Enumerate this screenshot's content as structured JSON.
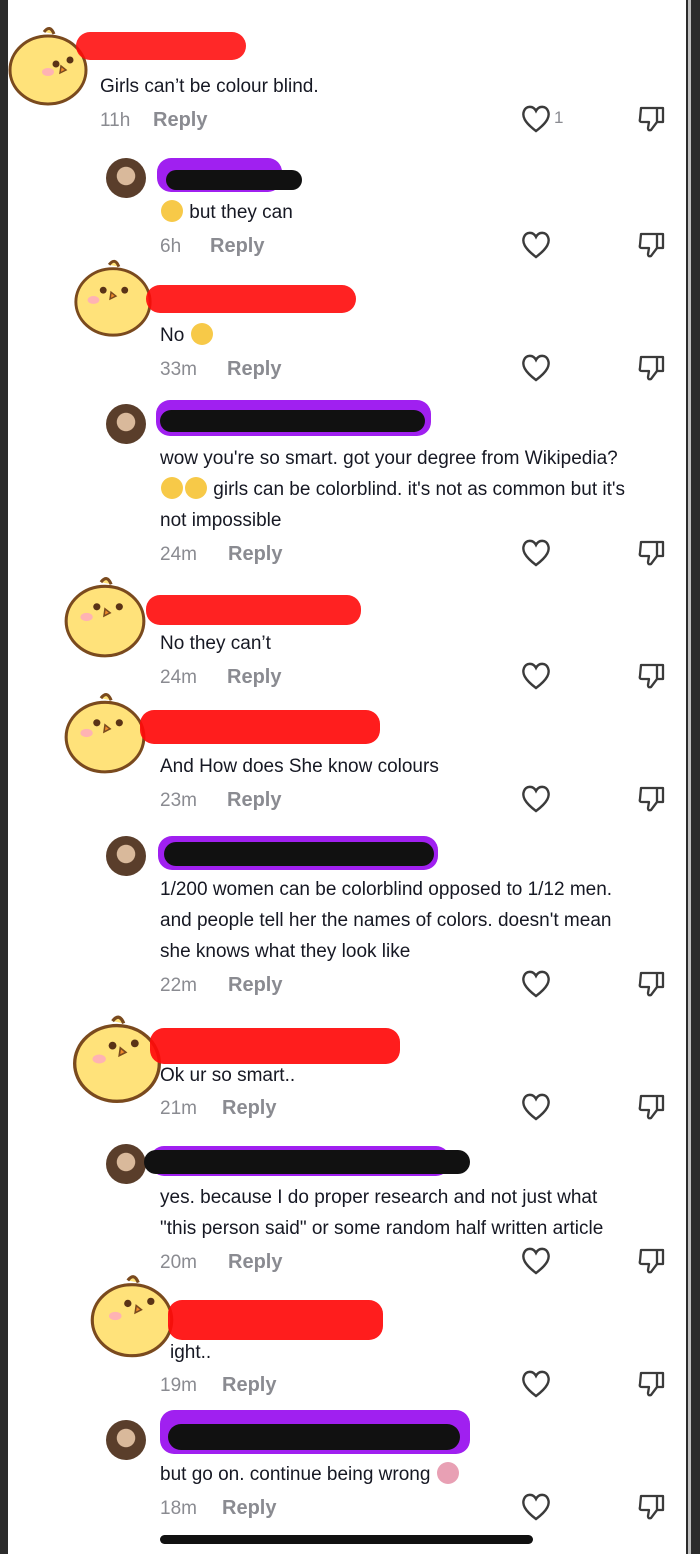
{
  "comments": [
    {
      "text": "Girls can’t be colour blind.",
      "time": "11h",
      "reply": "Reply",
      "likes": "1",
      "avatar": "chick",
      "redact": "#ff0a0a"
    },
    {
      "text": "but they can",
      "time": "6h",
      "reply": "Reply",
      "avatar": "photo",
      "redact": "#111111",
      "emoji": "scream-emoji"
    },
    {
      "text": "No",
      "time": "33m",
      "reply": "Reply",
      "avatar": "chick",
      "redact": "#ff0a0a",
      "emoji": "sunglasses-emoji"
    },
    {
      "lines": [
        "wow you're so smart. got your degree from Wikipedia?",
        "girls can be colorblind. it's not as common but it's",
        "not impossible"
      ],
      "time": "24m",
      "reply": "Reply",
      "avatar": "photo",
      "redact": "#111111"
    },
    {
      "text": "No they can’t",
      "time": "24m",
      "reply": "Reply",
      "avatar": "chick",
      "redact": "#ff0a0a"
    },
    {
      "text": "And How does She know colours",
      "time": "23m",
      "reply": "Reply",
      "avatar": "chick",
      "redact": "#ff0a0a"
    },
    {
      "lines": [
        "1/200 women can be colorblind opposed to 1/12 men.",
        "and people tell her the names of colors. doesn't mean",
        "she knows what they look like"
      ],
      "time": "22m",
      "reply": "Reply",
      "avatar": "photo",
      "redact": "#111111"
    },
    {
      "text": "Ok ur so smart..",
      "time": "21m",
      "reply": "Reply",
      "avatar": "chick",
      "redact": "#ff0a0a"
    },
    {
      "lines": [
        "yes. because I do proper research and not just what",
        "\"this person said\" or some random half written article"
      ],
      "time": "20m",
      "reply": "Reply",
      "avatar": "photo",
      "redact": "#111111"
    },
    {
      "text": "ight..",
      "time": "19m",
      "reply": "Reply",
      "avatar": "chick",
      "redact": "#ff0a0a"
    },
    {
      "text": "but go on. continue being wrong",
      "time": "18m",
      "reply": "Reply",
      "avatar": "photo",
      "redact": "#111111",
      "emoji": "shrug-emoji"
    }
  ],
  "colors": {
    "redact_red": "#ff0a0a",
    "redact_purple": "#a020f0",
    "redact_black": "#111111",
    "chick_yellow": "#ffe27a",
    "text": "#161823",
    "meta": "#8a8b91"
  }
}
